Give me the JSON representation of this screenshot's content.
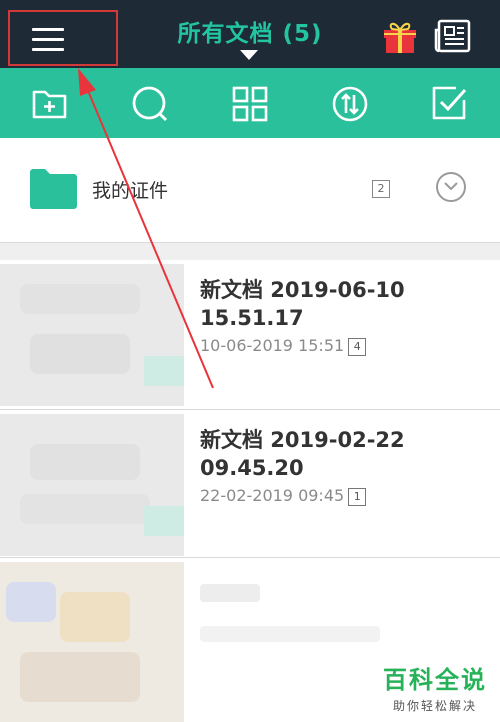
{
  "header": {
    "title": "所有文档 (5)",
    "menu_icon": "hamburger-menu-icon",
    "gift_icon": "gift-icon",
    "news_icon": "newspaper-icon",
    "colors": {
      "background": "#1e2a36",
      "title": "#22c5a0",
      "highlight_box": "#d23a3a"
    }
  },
  "toolbar": {
    "color": "#2ac09b",
    "tools": [
      {
        "icon": "new-folder-icon"
      },
      {
        "icon": "search-icon"
      },
      {
        "icon": "grid-view-icon"
      },
      {
        "icon": "sort-icon"
      },
      {
        "icon": "multi-select-icon"
      }
    ]
  },
  "folder": {
    "label": "我的证件",
    "count": "2",
    "icon": "folder-icon",
    "expand_icon": "chevron-down-icon"
  },
  "documents": [
    {
      "name_line1": "新文档 2019-06-10",
      "name_line2": "15.51.17",
      "date": "10-06-2019 15:51",
      "pages": "4"
    },
    {
      "name_line1": "新文档 2019-02-22",
      "name_line2": "09.45.20",
      "date": "22-02-2019 09:45",
      "pages": "1"
    }
  ],
  "watermark": {
    "main": "百科全说",
    "sub": "助你轻松解决"
  }
}
